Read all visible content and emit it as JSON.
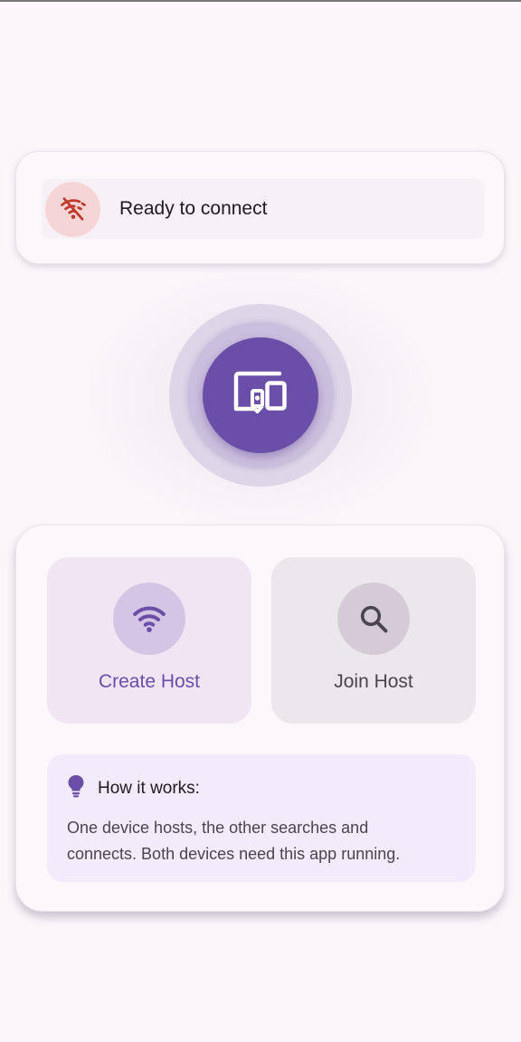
{
  "status": {
    "text": "Ready to connect",
    "icon": "wifi-off-icon",
    "color": "#c0392b"
  },
  "hero": {
    "icon": "devices-icon",
    "color": "#6a4ea8"
  },
  "actions": {
    "create": {
      "label": "Create Host",
      "icon": "wifi-icon"
    },
    "join": {
      "label": "Join Host",
      "icon": "search-icon"
    }
  },
  "info": {
    "icon": "lightbulb-icon",
    "title": "How it works:",
    "body_line1": "One device hosts, the other searches and",
    "body_line2": "connects. Both devices need this app running."
  },
  "colors": {
    "accent": "#6a4ea8",
    "background": "#fcf6fb",
    "error": "#c0392b"
  }
}
